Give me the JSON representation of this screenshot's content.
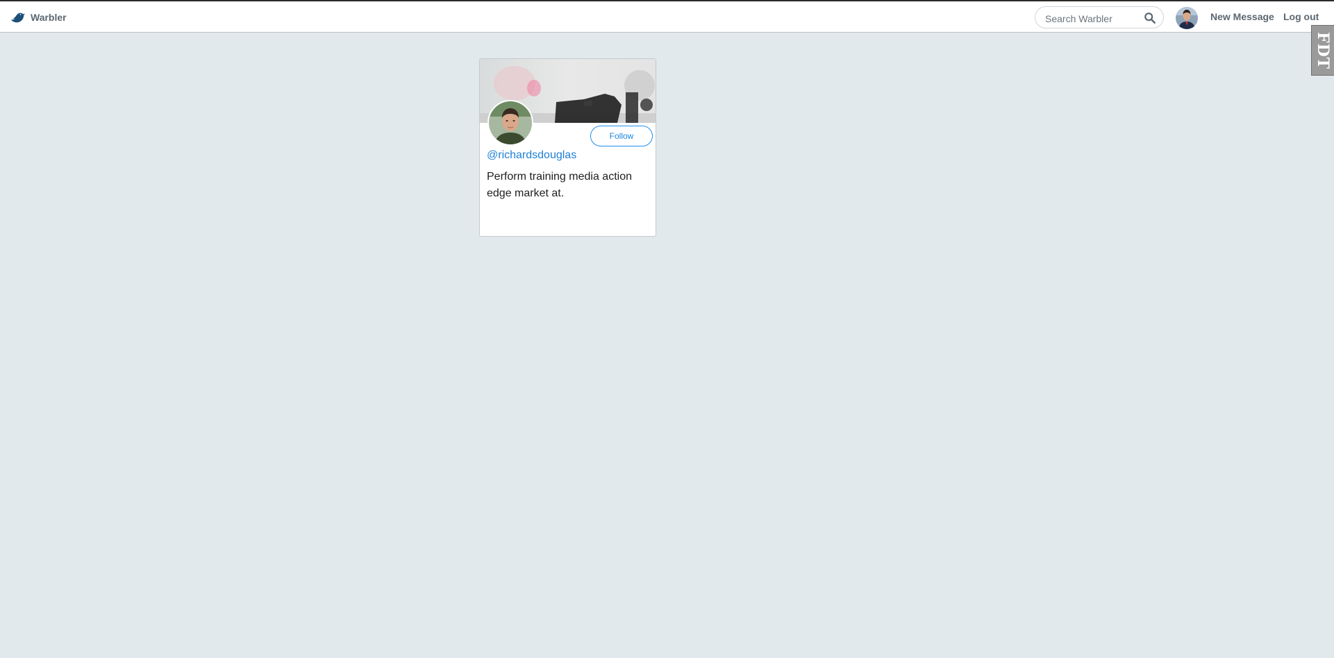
{
  "navbar": {
    "brand": "Warbler",
    "search_placeholder": "Search Warbler",
    "new_message": "New Message",
    "logout": "Log out"
  },
  "side_tab": {
    "label": "FDT"
  },
  "user_card": {
    "username": "@richardsdouglas",
    "follow_label": "Follow",
    "bio": "Perform training media action edge market at."
  },
  "icons": {
    "brand": "bird-icon",
    "search": "search-icon"
  },
  "colors": {
    "page_bg": "#e2e9ed",
    "link_blue": "#1e7fd5",
    "nav_text": "#5b6770"
  }
}
